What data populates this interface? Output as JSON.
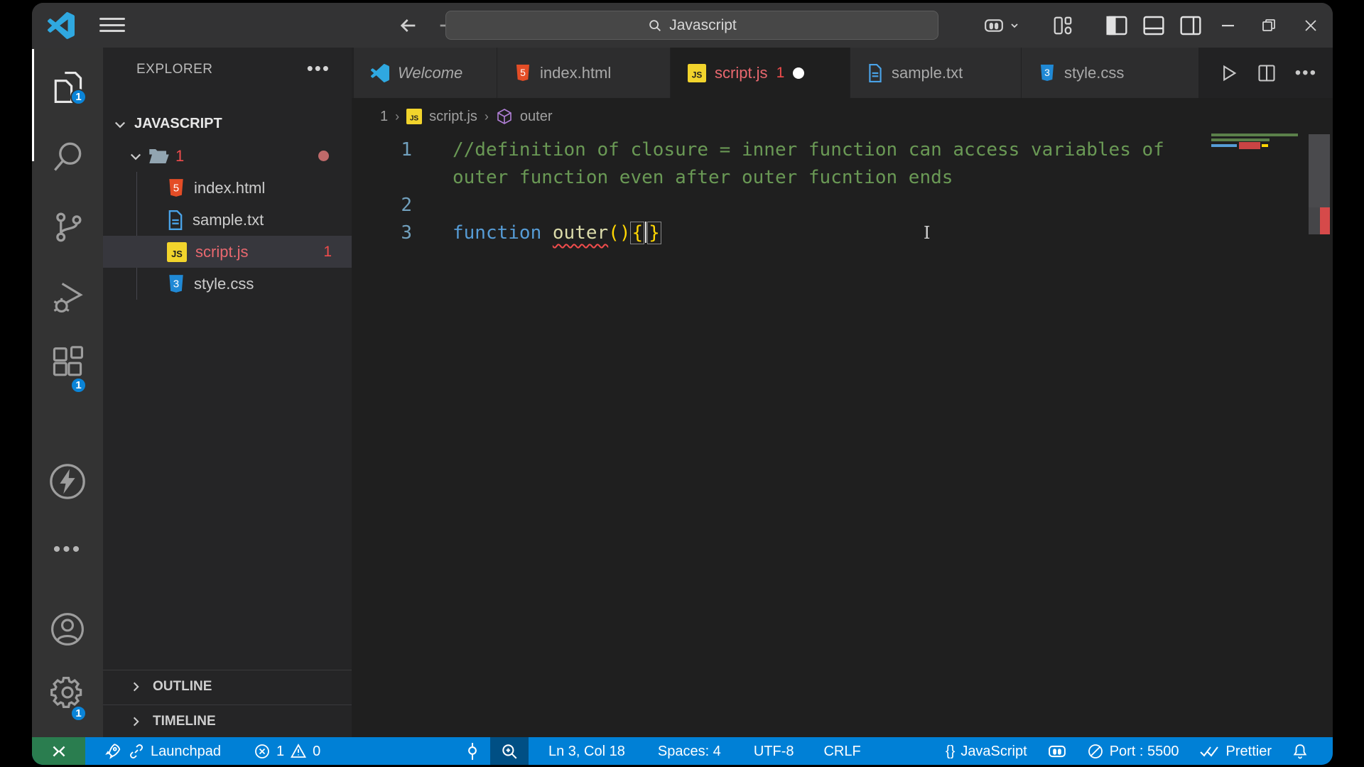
{
  "colors": {
    "statusbar_blue": "#0080d6",
    "remote_green": "#2a7d4f",
    "badge_blue": "#0a84d8",
    "error_red": "#f14c4c",
    "file_red": "#e9686f",
    "js_yellow": "#f2d42c",
    "html_orange": "#e44d26",
    "css_blue": "#2089d5",
    "txt_blue": "#4aa3e8",
    "comment_green": "#6a9955",
    "keyword_blue": "#569cd6",
    "function_yellow": "#dcdcaa",
    "brace_gold": "#ffd602",
    "symbol_purple": "#b180d7"
  },
  "title_bar": {
    "search_value": "Javascript"
  },
  "activity_bar": {
    "explorer_badge": "1",
    "extensions_badge": "1",
    "settings_badge": "1"
  },
  "sidebar": {
    "title": "EXPLORER",
    "section_label": "JAVASCRIPT",
    "folder": {
      "label": "1"
    },
    "files": [
      {
        "label": "index.html"
      },
      {
        "label": "sample.txt"
      },
      {
        "label": "script.js",
        "badge": "1"
      },
      {
        "label": "style.css"
      }
    ],
    "outline_label": "OUTLINE",
    "timeline_label": "TIMELINE"
  },
  "tabs": {
    "items": [
      {
        "label": "Welcome"
      },
      {
        "label": "index.html"
      },
      {
        "label": "script.js",
        "badge": "1"
      },
      {
        "label": "sample.txt"
      },
      {
        "label": "style.css"
      }
    ]
  },
  "breadcrumb": {
    "items": [
      {
        "label": "1"
      },
      {
        "label": "script.js"
      },
      {
        "label": "outer"
      }
    ]
  },
  "editor": {
    "line_numbers": {
      "l1": "1",
      "l2": "2",
      "l3": "3"
    },
    "code": {
      "comment_row1": "//definition of closure = inner function can access variables of",
      "comment_row2": "outer function even after outer fucntion ends",
      "keyword": "function",
      "function_name": "outer",
      "parens": "()",
      "brace_open": "{",
      "brace_close": "}"
    }
  },
  "status_bar": {
    "launchpad": "Launchpad",
    "errors": "1",
    "warnings": "0",
    "cursor": "Ln 3, Col 18",
    "spaces": "Spaces: 4",
    "encoding": "UTF-8",
    "eol": "CRLF",
    "braces": "{}",
    "language": "JavaScript",
    "port": "Port : 5500",
    "prettier": "Prettier"
  }
}
